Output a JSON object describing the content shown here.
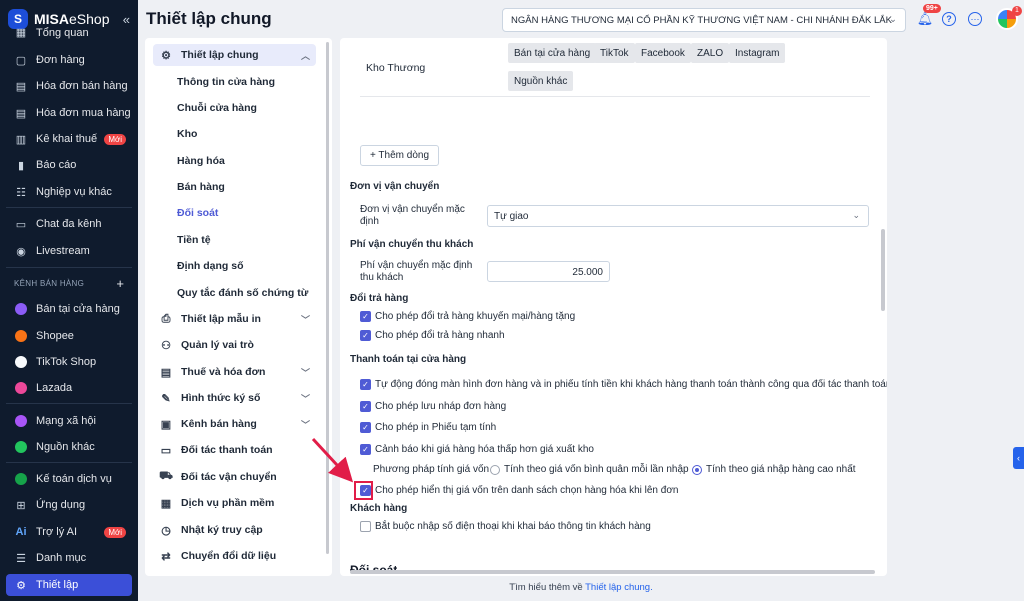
{
  "app": {
    "logo_brand": "MISA",
    "logo_product": "eShop",
    "collapse_icon": "double-chevron-left-icon"
  },
  "sidebar": {
    "items": [
      {
        "label": "Tổng quan",
        "icon": "dashboard-icon"
      },
      {
        "label": "Đơn hàng",
        "icon": "order-icon"
      },
      {
        "label": "Hóa đơn bán hàng",
        "icon": "sales-invoice-icon"
      },
      {
        "label": "Hóa đơn mua hàng",
        "icon": "purchase-invoice-icon"
      },
      {
        "label": "Kê khai thuế",
        "icon": "tax-icon",
        "badge": "Mới"
      },
      {
        "label": "Báo cáo",
        "icon": "report-icon"
      },
      {
        "label": "Nghiệp vụ khác",
        "icon": "other-ops-icon"
      },
      {
        "label": "Chat đa kênh",
        "icon": "chat-icon"
      },
      {
        "label": "Livestream",
        "icon": "livestream-icon"
      },
      {
        "label": "Bán tại cửa hàng",
        "icon": "store-icon"
      },
      {
        "label": "Shopee",
        "icon": "shopee-icon"
      },
      {
        "label": "TikTok Shop",
        "icon": "tiktok-icon"
      },
      {
        "label": "Lazada",
        "icon": "lazada-icon"
      },
      {
        "label": "Mạng xã hội",
        "icon": "social-icon"
      },
      {
        "label": "Nguồn khác",
        "icon": "other-source-icon"
      },
      {
        "label": "Kế toán dịch vụ",
        "icon": "accounting-icon"
      },
      {
        "label": "Ứng dụng",
        "icon": "apps-icon"
      },
      {
        "label": "Trợ lý AI",
        "icon": "ai-icon",
        "badge": "Mới"
      },
      {
        "label": "Danh mục",
        "icon": "list-icon"
      },
      {
        "label": "Thiết lập",
        "icon": "gear-icon"
      }
    ],
    "section_label": "KÊNH BÁN HÀNG",
    "section_add": "+"
  },
  "header": {
    "title": "Thiết lập chung",
    "branch": "NGÂN HÀNG THƯƠNG MẠI CỔ PHẦN KỸ THƯƠNG VIỆT NAM - CHI NHÁNH ĐẮK LẮK",
    "bell_badge": "99+",
    "avatar_badge": "1"
  },
  "settings_menu": {
    "top": [
      {
        "label": "Thiết lập chung",
        "icon": "settings-icon"
      },
      {
        "label": "Thiết lập mẫu in",
        "icon": "printer-icon"
      },
      {
        "label": "Quản lý vai trò",
        "icon": "user-role-icon"
      },
      {
        "label": "Thuế và hóa đơn",
        "icon": "tax-invoice-icon"
      },
      {
        "label": "Hình thức ký số",
        "icon": "signature-icon"
      },
      {
        "label": "Kênh bán hàng",
        "icon": "channel-icon"
      },
      {
        "label": "Đối tác thanh toán",
        "icon": "payment-partner-icon"
      },
      {
        "label": "Đối tác vận chuyển",
        "icon": "shipping-partner-icon"
      },
      {
        "label": "Dịch vụ phần mềm",
        "icon": "software-service-icon"
      },
      {
        "label": "Nhật ký truy cập",
        "icon": "access-log-icon"
      },
      {
        "label": "Chuyển đổi dữ liệu",
        "icon": "data-convert-icon"
      }
    ],
    "sub": [
      "Thông tin cửa hàng",
      "Chuỗi cửa hàng",
      "Kho",
      "Hàng hóa",
      "Bán hàng",
      "Đối soát",
      "Tiền tệ",
      "Định dạng số",
      "Quy tắc đánh số chứng từ"
    ]
  },
  "content": {
    "warehouse_name": "Kho Thương",
    "channels": [
      "Bán tại cửa hàng",
      "TikTok",
      "Facebook",
      "ZALO",
      "Instagram",
      "Nguồn khác"
    ],
    "add_row": "+ Thêm dòng",
    "shipping": {
      "heading": "Đơn vị vận chuyển",
      "default_label": "Đơn vị vận chuyển mặc định",
      "default_value": "Tự giao"
    },
    "fee": {
      "heading": "Phí vận chuyển thu khách",
      "default_label": "Phí vận chuyển mặc định thu khách",
      "default_value": "25.000"
    },
    "returns": {
      "heading": "Đổi trả hàng",
      "options": [
        {
          "label": "Cho phép đổi trả hàng khuyến mại/hàng tặng",
          "checked": true
        },
        {
          "label": "Cho phép đổi trả hàng nhanh",
          "checked": true
        }
      ]
    },
    "store_payment": {
      "heading": "Thanh toán tại cửa hàng",
      "options": [
        {
          "label": "Tự động đóng màn hình đơn hàng và in phiếu tính tiền khi khách hàng thanh toán thành công qua đối tác thanh toán",
          "checked": true
        },
        {
          "label": "Cho phép lưu nháp đơn hàng",
          "checked": true
        },
        {
          "label": "Cho phép in Phiếu tạm tính",
          "checked": true
        },
        {
          "label": "Cảnh báo khi giá hàng hóa thấp hơn giá xuất kho",
          "checked": true
        }
      ],
      "cost_method_label": "Phương pháp tính giá vốn",
      "cost_methods": [
        {
          "label": "Tính theo giá vốn bình quân mỗi lần nhập",
          "selected": false
        },
        {
          "label": "Tính theo giá nhập hàng cao nhất",
          "selected": true
        }
      ],
      "show_cost": {
        "label": "Cho phép hiển thị giá vốn trên danh sách chọn hàng hóa khi lên đơn",
        "checked": true
      }
    },
    "customer": {
      "heading": "Khách hàng",
      "options": [
        {
          "label": "Bắt buộc nhập số điện thoại khi khai báo thông tin khách hàng",
          "checked": false
        }
      ]
    },
    "peek_heading": "Đối soát"
  },
  "footer": {
    "prefix": "Tìm hiểu thêm về ",
    "link": "Thiết lập chung."
  },
  "colors": {
    "accent": "#4f5bd5",
    "sidebar_bg": "#0f1b2d",
    "active_nav": "#3b4fd8",
    "annotation": "#e11d48"
  }
}
